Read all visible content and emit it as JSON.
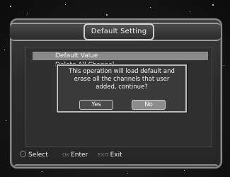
{
  "window": {
    "title": "Default Setting"
  },
  "menu": {
    "items": [
      {
        "label": "Default Value",
        "selected": true
      },
      {
        "label": "Delete All Channel",
        "selected": false
      }
    ]
  },
  "dialog": {
    "message_line1": "This operation will load default and",
    "message_line2": "erase all the channels that user",
    "message_line3": "added, continue?",
    "yes_label": "Yes",
    "no_label": "No",
    "focused_button": "No"
  },
  "footer": {
    "select_label": "Select",
    "enter_key": "OK",
    "enter_label": "Enter",
    "exit_key": "EXIT",
    "exit_label": "Exit"
  },
  "icons": {
    "select_icon": "navigate-arrows-icon"
  },
  "colors": {
    "selection_bg": "#8a8a8a",
    "focused_button_bg": "#8c8c8c",
    "text": "#f2f2f2"
  }
}
